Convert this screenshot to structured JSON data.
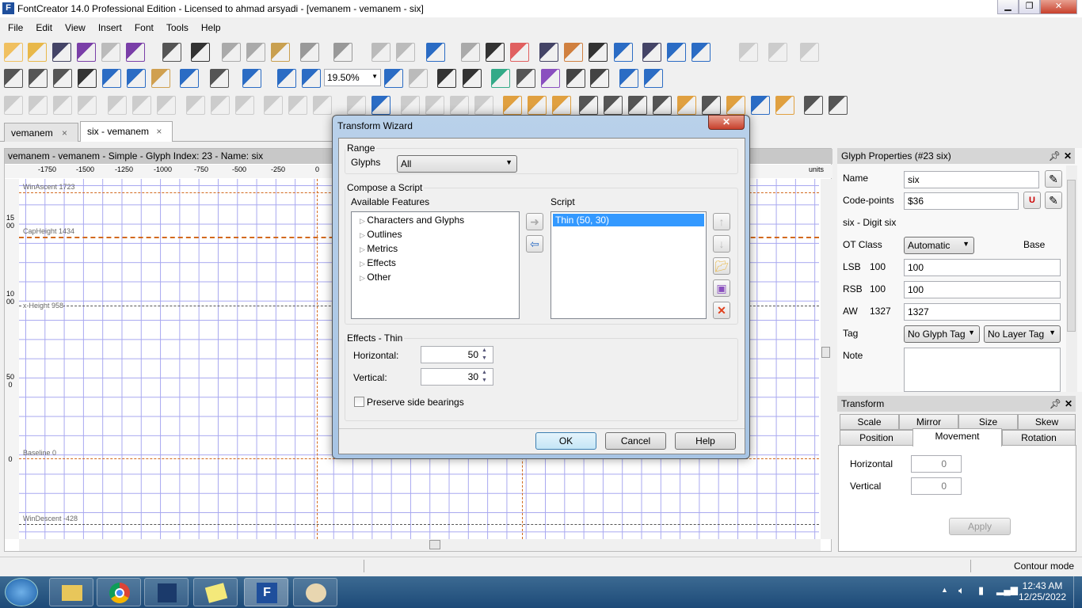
{
  "window": {
    "title": "FontCreator 14.0 Professional Edition - Licensed to ahmad arsyadi - [vemanem - vemanem - six]"
  },
  "menu": [
    "File",
    "Edit",
    "View",
    "Insert",
    "Font",
    "Tools",
    "Help"
  ],
  "toolbar": {
    "zoom_value": "19.50%"
  },
  "tabs": [
    {
      "label": "vemanem",
      "close": "×"
    },
    {
      "label": "six - vemanem",
      "close": "×"
    }
  ],
  "editor": {
    "header": "vemanem - vemanem - Simple - Glyph Index: 23 - Name: six",
    "ruler_ticks": [
      "-1750",
      "-1500",
      "-1250",
      "-1000",
      "-750",
      "-500",
      "-250",
      "0"
    ],
    "ruler_units": "units",
    "vruler": [
      "1500",
      "1000",
      "500",
      "0"
    ],
    "guidelines": [
      {
        "label": "WinAscent 1723"
      },
      {
        "label": "CapHeight 1434"
      },
      {
        "label": "x-Height 958"
      },
      {
        "label": "Baseline 0"
      },
      {
        "label": "WinDescent -428"
      }
    ],
    "guide_color": "#d2691e",
    "grid_color": "#a8a8f0"
  },
  "dialog": {
    "title": "Transform Wizard",
    "close": "✕",
    "range": {
      "legend": "Range",
      "glyphs_label": "Glyphs",
      "glyphs_value": "All"
    },
    "compose": {
      "legend": "Compose a Script",
      "available_label": "Available Features",
      "script_label": "Script",
      "features": [
        "Characters and Glyphs",
        "Outlines",
        "Metrics",
        "Effects",
        "Other"
      ],
      "script_items": [
        "Thin (50, 30)"
      ]
    },
    "effects": {
      "legend": "Effects - Thin",
      "horizontal_label": "Horizontal:",
      "horizontal_value": "50",
      "vertical_label": "Vertical:",
      "vertical_value": "30",
      "preserve_label": "Preserve side bearings",
      "preserve_checked": false
    },
    "buttons": {
      "ok": "OK",
      "cancel": "Cancel",
      "help": "Help"
    },
    "selection_color": "#3399ff"
  },
  "glyph_props": {
    "title": "Glyph Properties (#23 six)",
    "name_label": "Name",
    "name_value": "six",
    "codepoints_label": "Code-points",
    "codepoints_value": "$36",
    "description": "six - Digit six",
    "otclass_label": "OT Class",
    "otclass_value": "Automatic",
    "otclass_extra": "Base",
    "lsb_label": "LSB",
    "lsb_current": "100",
    "lsb_value": "100",
    "rsb_label": "RSB",
    "rsb_current": "100",
    "rsb_value": "100",
    "aw_label": "AW",
    "aw_current": "1327",
    "aw_value": "1327",
    "tag_label": "Tag",
    "glyph_tag": "No Glyph Tag",
    "layer_tag": "No Layer Tag",
    "note_label": "Note"
  },
  "transform": {
    "title": "Transform",
    "tabs_row1": [
      "Scale",
      "Mirror",
      "Size",
      "Skew"
    ],
    "tabs_row2": [
      "Position",
      "Movement",
      "Rotation"
    ],
    "active_tab": "Movement",
    "horizontal_label": "Horizontal",
    "horizontal_value": "0",
    "vertical_label": "Vertical",
    "vertical_value": "0",
    "apply": "Apply"
  },
  "status": {
    "mode": "Contour mode"
  },
  "taskbar": {
    "time": "12:43 AM",
    "date": "12/25/2022",
    "apps": [
      "start",
      "file-explorer",
      "chrome",
      "affinity",
      "sticky-notes",
      "fontcreator",
      "paint"
    ]
  }
}
